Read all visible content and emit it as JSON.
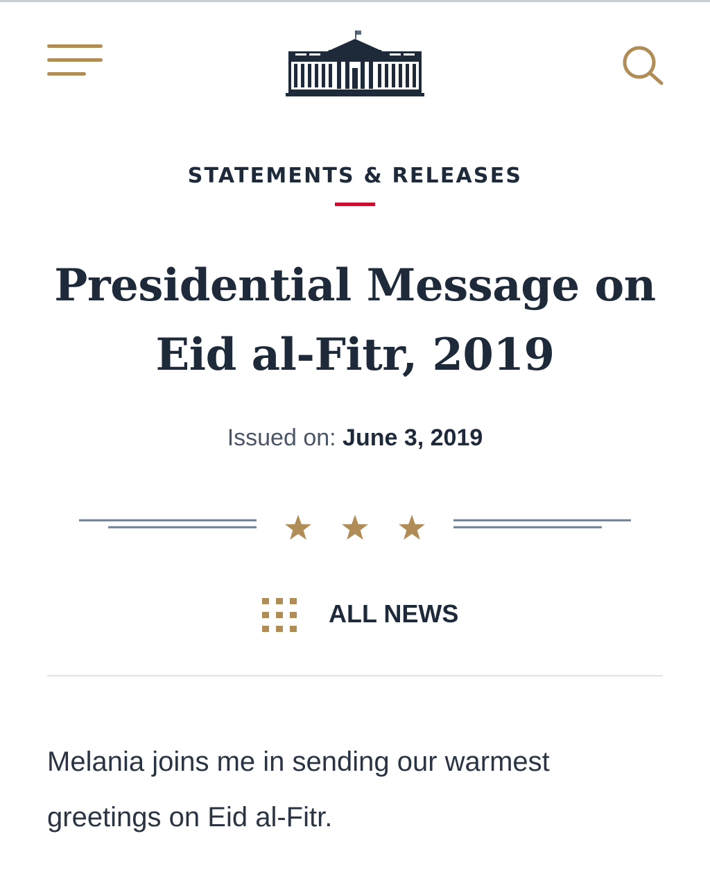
{
  "header": {
    "menu_icon": "hamburger-menu-icon",
    "logo_icon": "white-house-logo",
    "search_icon": "search-icon",
    "accent_color": "#b08d57",
    "navy_color": "#1e2a3a"
  },
  "article": {
    "section_label": "STATEMENTS & RELEASES",
    "title_line1": "Presidential Message on",
    "title_line2": "Eid al-Fitr, 2019",
    "issued_prefix": "Issued on:",
    "issued_date": "June 3, 2019",
    "divider_icon": "three-stars-divider",
    "all_news_icon": "grid-icon",
    "all_news_label": "ALL NEWS",
    "body_paragraph": "Melania joins me in sending our warmest greetings on Eid al-Fitr.",
    "accent_red": "#c8102e"
  }
}
